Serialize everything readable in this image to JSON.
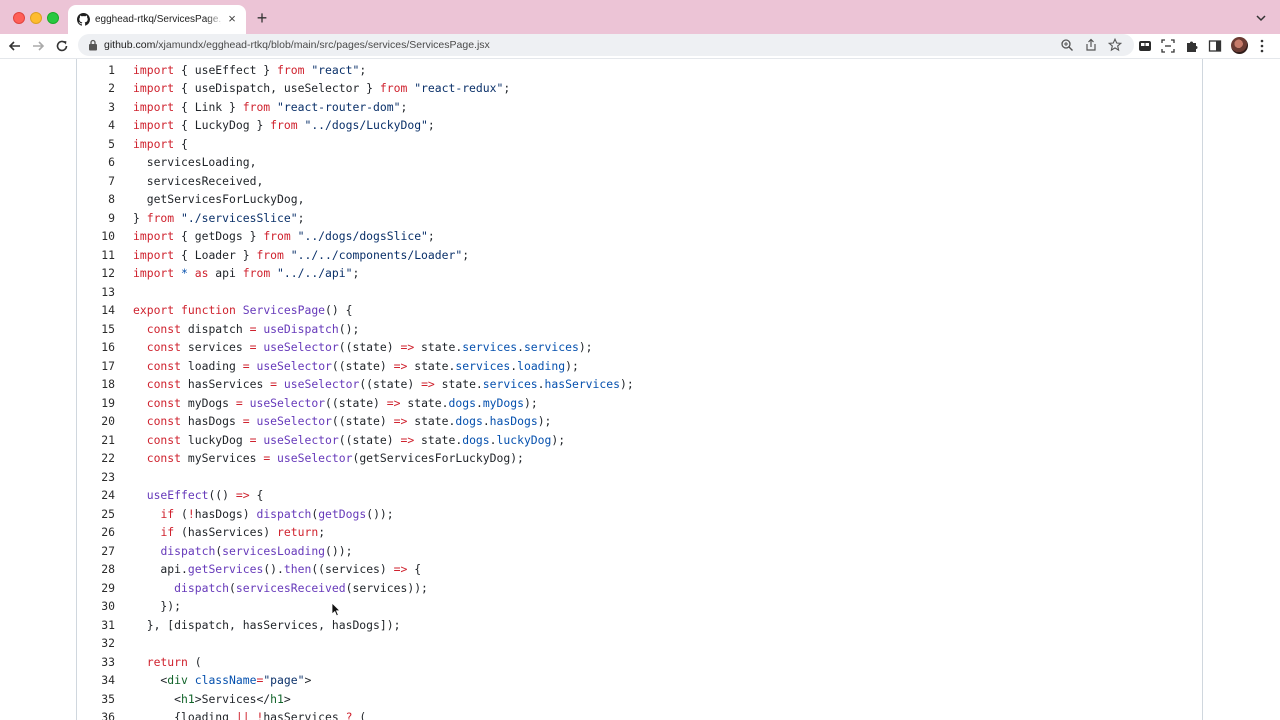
{
  "browser": {
    "tab_title": "egghead-rtkq/ServicesPage.jsx",
    "tab_close": "×",
    "new_tab": "+",
    "url_host": "github.com",
    "url_path": "/xjamundx/egghead-rtkq/blob/main/src/pages/services/ServicesPage.jsx"
  },
  "icons": {
    "tab": "github-icon",
    "back": "back-arrow-icon",
    "forward": "forward-arrow-icon",
    "reload": "reload-icon",
    "lock": "lock-icon",
    "zoom": "zoom-icon",
    "share": "share-icon",
    "bookmark": "star-icon",
    "extensions": "puzzle-icon"
  },
  "colors": {
    "tab_strip": "#ecc4d6",
    "keyword": "#cf222e",
    "string": "#0a3069",
    "function": "#6639ba",
    "property": "#0550ae",
    "jsx_tag": "#116329"
  },
  "code": {
    "language": "jsx",
    "lines": [
      {
        "n": "1",
        "html": "<span class=\"k\">import</span> { useEffect } <span class=\"k\">from</span> <span class=\"s\">\"react\"</span>;"
      },
      {
        "n": "2",
        "html": "<span class=\"k\">import</span> { useDispatch, useSelector } <span class=\"k\">from</span> <span class=\"s\">\"react-redux\"</span>;"
      },
      {
        "n": "3",
        "html": "<span class=\"k\">import</span> { Link } <span class=\"k\">from</span> <span class=\"s\">\"react-router-dom\"</span>;"
      },
      {
        "n": "4",
        "html": "<span class=\"k\">import</span> { LuckyDog } <span class=\"k\">from</span> <span class=\"s\">\"../dogs/LuckyDog\"</span>;"
      },
      {
        "n": "5",
        "html": "<span class=\"k\">import</span> {"
      },
      {
        "n": "6",
        "html": "  servicesLoading,"
      },
      {
        "n": "7",
        "html": "  servicesReceived,"
      },
      {
        "n": "8",
        "html": "  getServicesForLuckyDog,"
      },
      {
        "n": "9",
        "html": "} <span class=\"k\">from</span> <span class=\"s\">\"./servicesSlice\"</span>;"
      },
      {
        "n": "10",
        "html": "<span class=\"k\">import</span> { getDogs } <span class=\"k\">from</span> <span class=\"s\">\"../dogs/dogsSlice\"</span>;"
      },
      {
        "n": "11",
        "html": "<span class=\"k\">import</span> { Loader } <span class=\"k\">from</span> <span class=\"s\">\"../../components/Loader\"</span>;"
      },
      {
        "n": "12",
        "html": "<span class=\"k\">import</span> <span class=\"p\">*</span> <span class=\"k\">as</span> api <span class=\"k\">from</span> <span class=\"s\">\"../../api\"</span>;"
      },
      {
        "n": "13",
        "html": ""
      },
      {
        "n": "14",
        "html": "<span class=\"k\">export</span> <span class=\"k\">function</span> <span class=\"f\">ServicesPage</span>() {"
      },
      {
        "n": "15",
        "html": "  <span class=\"k\">const</span> dispatch <span class=\"k\">=</span> <span class=\"f\">useDispatch</span>();"
      },
      {
        "n": "16",
        "html": "  <span class=\"k\">const</span> services <span class=\"k\">=</span> <span class=\"f\">useSelector</span>((state) <span class=\"k\">=&gt;</span> state.<span class=\"p\">services</span>.<span class=\"p\">services</span>);"
      },
      {
        "n": "17",
        "html": "  <span class=\"k\">const</span> loading <span class=\"k\">=</span> <span class=\"f\">useSelector</span>((state) <span class=\"k\">=&gt;</span> state.<span class=\"p\">services</span>.<span class=\"p\">loading</span>);"
      },
      {
        "n": "18",
        "html": "  <span class=\"k\">const</span> hasServices <span class=\"k\">=</span> <span class=\"f\">useSelector</span>((state) <span class=\"k\">=&gt;</span> state.<span class=\"p\">services</span>.<span class=\"p\">hasServices</span>);"
      },
      {
        "n": "19",
        "html": "  <span class=\"k\">const</span> myDogs <span class=\"k\">=</span> <span class=\"f\">useSelector</span>((state) <span class=\"k\">=&gt;</span> state.<span class=\"p\">dogs</span>.<span class=\"p\">myDogs</span>);"
      },
      {
        "n": "20",
        "html": "  <span class=\"k\">const</span> hasDogs <span class=\"k\">=</span> <span class=\"f\">useSelector</span>((state) <span class=\"k\">=&gt;</span> state.<span class=\"p\">dogs</span>.<span class=\"p\">hasDogs</span>);"
      },
      {
        "n": "21",
        "html": "  <span class=\"k\">const</span> luckyDog <span class=\"k\">=</span> <span class=\"f\">useSelector</span>((state) <span class=\"k\">=&gt;</span> state.<span class=\"p\">dogs</span>.<span class=\"p\">luckyDog</span>);"
      },
      {
        "n": "22",
        "html": "  <span class=\"k\">const</span> myServices <span class=\"k\">=</span> <span class=\"f\">useSelector</span>(getServicesForLuckyDog);"
      },
      {
        "n": "23",
        "html": ""
      },
      {
        "n": "24",
        "html": "  <span class=\"f\">useEffect</span>(() <span class=\"k\">=&gt;</span> {"
      },
      {
        "n": "25",
        "html": "    <span class=\"k\">if</span> (<span class=\"k\">!</span>hasDogs) <span class=\"f\">dispatch</span>(<span class=\"f\">getDogs</span>());"
      },
      {
        "n": "26",
        "html": "    <span class=\"k\">if</span> (hasServices) <span class=\"k\">return</span>;"
      },
      {
        "n": "27",
        "html": "    <span class=\"f\">dispatch</span>(<span class=\"f\">servicesLoading</span>());"
      },
      {
        "n": "28",
        "html": "    api.<span class=\"f\">getServices</span>().<span class=\"f\">then</span>((services) <span class=\"k\">=&gt;</span> {"
      },
      {
        "n": "29",
        "html": "      <span class=\"f\">dispatch</span>(<span class=\"f\">servicesReceived</span>(services));"
      },
      {
        "n": "30",
        "html": "    });"
      },
      {
        "n": "31",
        "html": "  }, [dispatch, hasServices, hasDogs]);"
      },
      {
        "n": "32",
        "html": ""
      },
      {
        "n": "33",
        "html": "  <span class=\"k\">return</span> ("
      },
      {
        "n": "34",
        "html": "    &lt;<span class=\"t\">div</span> <span class=\"p\">className</span><span class=\"k\">=</span><span class=\"s\">\"page\"</span>&gt;"
      },
      {
        "n": "35",
        "html": "      &lt;<span class=\"t\">h1</span>&gt;Services&lt;/<span class=\"t\">h1</span>&gt;"
      },
      {
        "n": "36",
        "html": "      {loading <span class=\"k\">||</span> <span class=\"k\">!</span>hasServices <span class=\"k\">?</span> ("
      }
    ]
  }
}
